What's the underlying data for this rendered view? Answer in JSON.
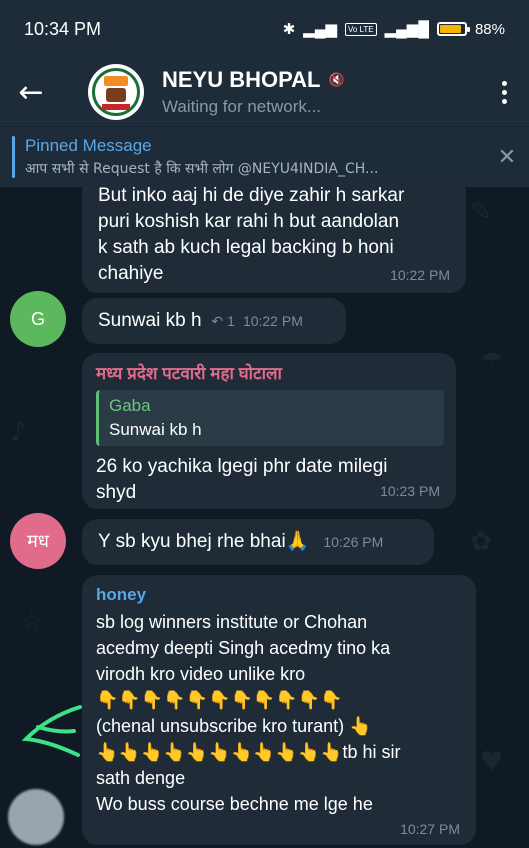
{
  "status_bar": {
    "time": "10:34 PM",
    "battery_percent": "88%",
    "battery_level": 0.88,
    "network_label": "Vo LTE"
  },
  "header": {
    "back_icon": "back-arrow-icon",
    "title": "NEYU BHOPAL",
    "muted_icon": "mute-icon",
    "subtitle": "Waiting for network...",
    "menu_icon": "more-vert-icon"
  },
  "pinned": {
    "title": "Pinned Message",
    "text": "आप सभी से Request है कि सभी लोग @NEYU4INDIA_CH...",
    "close_icon": "close-icon"
  },
  "messages": [
    {
      "text": "But inko aaj hi de diye zahir h sarkar\npuri koshish kar rahi h but aandolan\nk sath ab kuch legal backing b honi\nchahiye",
      "time": "10:22 PM"
    },
    {
      "avatar_initial": "G",
      "avatar_color": "#5cb85c",
      "text": "Sunwai kb h",
      "reply_count": "1",
      "time": "10:22 PM"
    },
    {
      "sender": "मध्य प्रदेश पटवारी महा घोटाला",
      "sender_color": "#e06b8b",
      "reply_name": "Gaba",
      "reply_text": "Sunwai kb h",
      "text": "26 ko yachika lgegi phr date milegi\nshyd",
      "time": "10:23 PM"
    },
    {
      "avatar_initial": "मध",
      "avatar_color": "#e06b8b",
      "text": "Y sb kyu bhej rhe bhai🙏",
      "time": "10:26 PM"
    },
    {
      "sender": "honey",
      "sender_color": "#5aa7e6",
      "text": "sb log winners institute or Chohan\nacedmy deepti Singh acedmy tino ka\nvirodh kro video unlike kro\n👇👇👇👇👇👇👇👇👇👇👇\n(chenal unsubscribe kro turant) 👆\n👆👆👆👆👆👆👆👆👆👆👆tb hi sir\nsath denge\nWo buss course bechne me lge he",
      "time": "10:27 PM"
    }
  ]
}
